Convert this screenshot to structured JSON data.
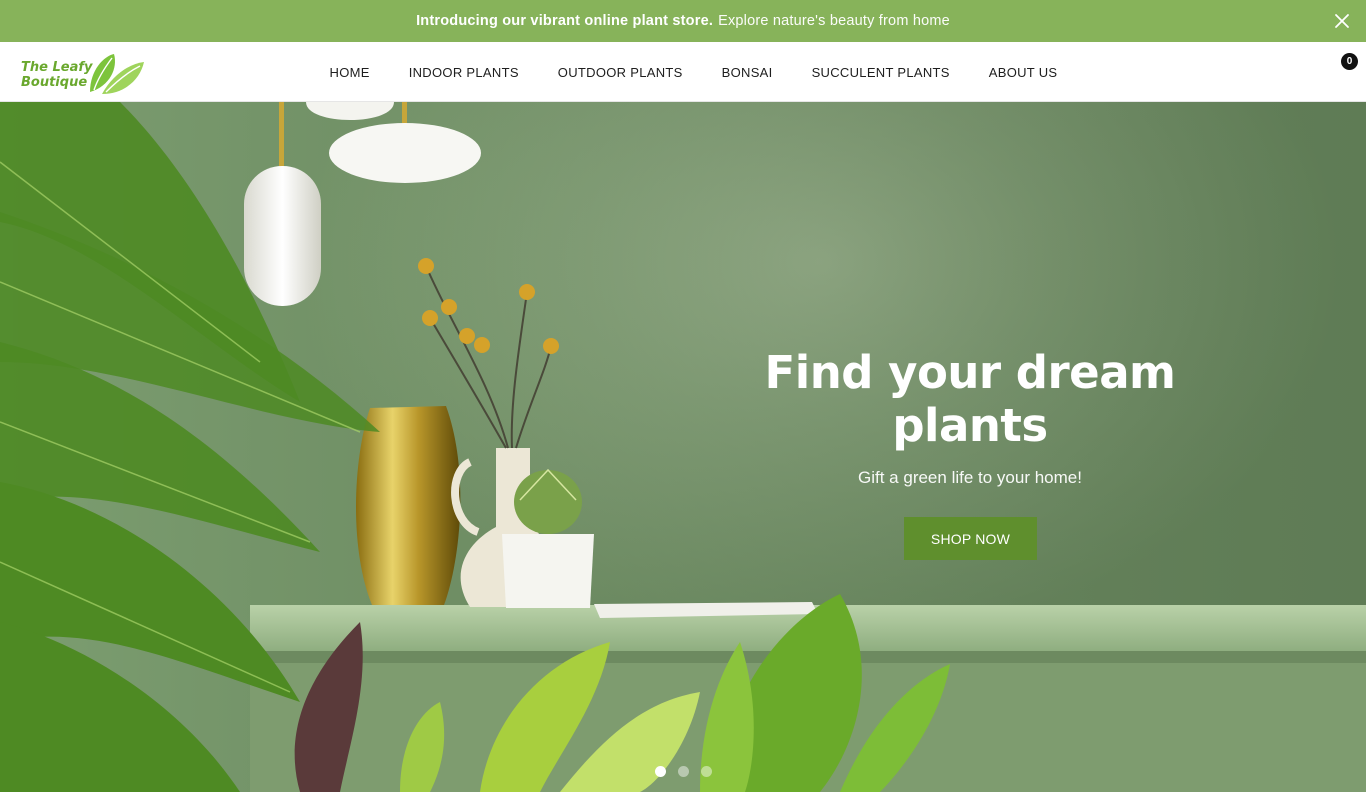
{
  "announcement": {
    "bold_text": "Introducing our vibrant online plant store.",
    "text": "Explore nature's beauty from home"
  },
  "header": {
    "logo_line1": "The Leafy",
    "logo_line2": "Boutique",
    "nav": [
      {
        "label": "HOME"
      },
      {
        "label": "INDOOR PLANTS"
      },
      {
        "label": "OUTDOOR PLANTS"
      },
      {
        "label": "BONSAI"
      },
      {
        "label": "SUCCULENT PLANTS"
      },
      {
        "label": "ABOUT US"
      }
    ],
    "cart_count": "0"
  },
  "hero": {
    "title": "Find your dream plants",
    "subtitle": "Gift a green life to your home!",
    "cta": "SHOP NOW",
    "slides": 3,
    "active_slide": 1
  },
  "icons": {
    "close": "close-icon",
    "cart": "cart-icon",
    "logo": "leaf-icon"
  },
  "colors": {
    "announce_bg": "#87b35a",
    "cta_bg": "#5f8f2d",
    "hero_bg": "#93b286",
    "logo_green": "#6aa82e"
  }
}
